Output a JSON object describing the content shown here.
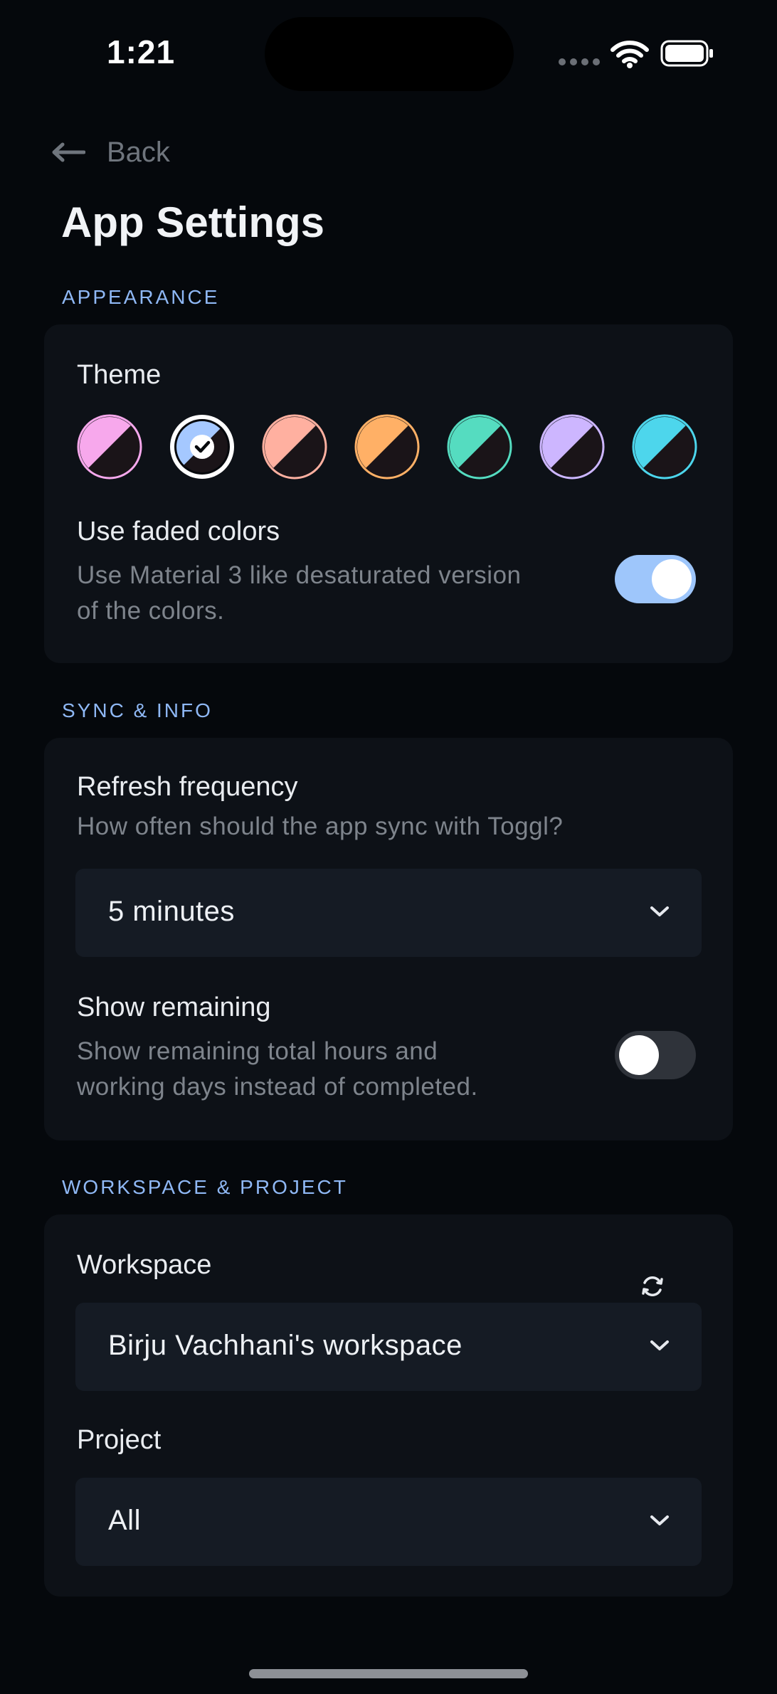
{
  "status_bar": {
    "time": "1:21",
    "icons": [
      "cellular-dots-icon",
      "wifi-icon",
      "battery-icon"
    ]
  },
  "nav": {
    "back_icon": "arrow-left-icon",
    "back_label": "Back"
  },
  "page": {
    "title": "App Settings"
  },
  "appearance": {
    "section_label": "APPEARANCE",
    "theme_label": "Theme",
    "themes": [
      {
        "name": "pink",
        "color": "#f7a8ec",
        "selected": false
      },
      {
        "name": "blue",
        "color": "#a5c8ff",
        "selected": true
      },
      {
        "name": "salmon",
        "color": "#ffb0a0",
        "selected": false
      },
      {
        "name": "orange",
        "color": "#ffb066",
        "selected": false
      },
      {
        "name": "teal",
        "color": "#55dcc0",
        "selected": false
      },
      {
        "name": "lavender",
        "color": "#cdb6ff",
        "selected": false
      },
      {
        "name": "cyan",
        "color": "#4dd6ec",
        "selected": false
      }
    ],
    "faded_title": "Use faded colors",
    "faded_desc_line1": "Use Material 3 like desaturated version",
    "faded_desc_line2": "of the colors.",
    "faded_enabled": true
  },
  "sync": {
    "section_label": "SYNC & INFO",
    "refresh_title": "Refresh frequency",
    "refresh_desc": "How often should the app sync with Toggl?",
    "refresh_value": "5 minutes",
    "remaining_title": "Show remaining",
    "remaining_desc_line1": "Show remaining total hours and",
    "remaining_desc_line2": "working days instead of completed.",
    "remaining_enabled": false
  },
  "workspace": {
    "section_label": "WORKSPACE & PROJECT",
    "workspace_label": "Workspace",
    "workspace_value": "Birju Vachhani's workspace",
    "refresh_icon": "sync-icon",
    "project_label": "Project",
    "project_value": "All"
  },
  "colors": {
    "accent": "#a5c8ff",
    "background": "#05080c",
    "card": "#0d1117",
    "section_label": "#8fb8f5"
  }
}
